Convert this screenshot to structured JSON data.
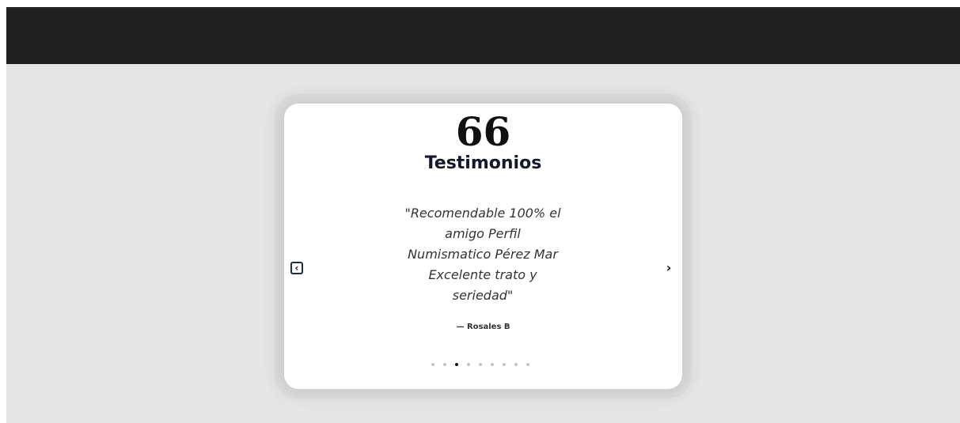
{
  "testimonial": {
    "quote_icon": "66",
    "title": "Testimonios",
    "text": "\"Recomendable 100% el amigo Perfil Numismatico Pérez Mar Excelente trato y seriedad\"",
    "author": "— Rosales B"
  },
  "navigation": {
    "prev_icon": "chevron-left-icon",
    "next_icon": "chevron-right-icon",
    "prev_glyph": "‹",
    "next_glyph": "›"
  },
  "pagination": {
    "total": 9,
    "active_index": 2
  },
  "colors": {
    "topbar": "#212121",
    "page_background": "#e6e6e6",
    "card_background": "#ffffff",
    "title": "#15172a",
    "text": "#333333",
    "dot_active": "#111111",
    "dot_inactive": "#c4c4c4"
  }
}
